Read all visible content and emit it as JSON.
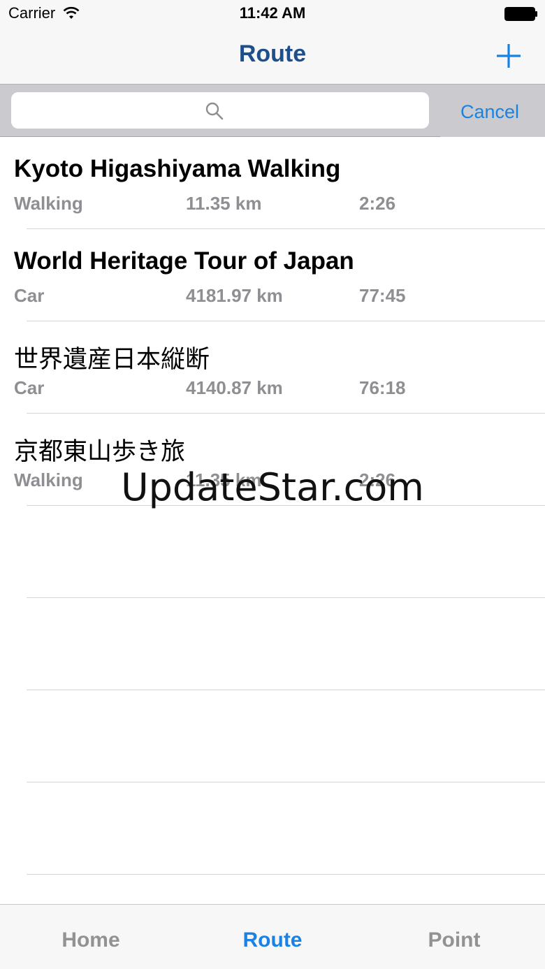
{
  "status_bar": {
    "carrier": "Carrier",
    "time": "11:42 AM"
  },
  "nav": {
    "title": "Route",
    "add_icon": "plus-icon"
  },
  "search": {
    "value": "",
    "placeholder": "",
    "cancel_label": "Cancel"
  },
  "routes": [
    {
      "name": "Kyoto Higashiyama Walking",
      "mode": "Walking",
      "distance": "11.35 km",
      "time": "2:26"
    },
    {
      "name": "World Heritage Tour of Japan",
      "mode": "Car",
      "distance": "4181.97 km",
      "time": "77:45"
    },
    {
      "name": "世界遺産日本縦断",
      "mode": "Car",
      "distance": "4140.87 km",
      "time": "76:18"
    },
    {
      "name": "京都東山歩き旅",
      "mode": "Walking",
      "distance": "11.35 km",
      "time": "2:26"
    }
  ],
  "watermark": "UpdateStar.com",
  "tabs": [
    {
      "label": "Home"
    },
    {
      "label": "Route"
    },
    {
      "label": "Point"
    }
  ],
  "colors": {
    "accent": "#1a82e2",
    "title": "#1e4f8c",
    "secondary_text": "#8e8e93"
  }
}
